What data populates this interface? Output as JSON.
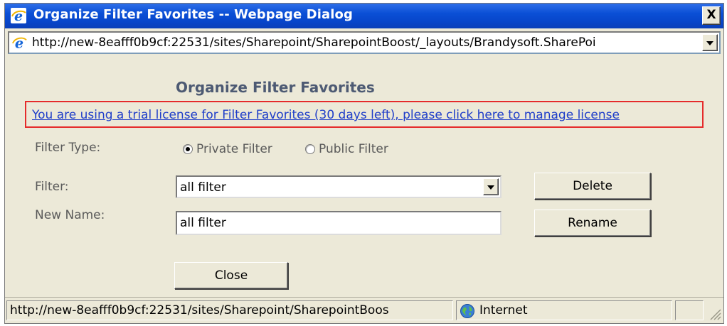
{
  "window": {
    "title": "Organize Filter Favorites -- Webpage Dialog",
    "close_glyph": "X",
    "address": "http://new-8eafff0b9cf:22531/sites/Sharepoint/SharepointBoost/_layouts/Brandysoft.SharePoi"
  },
  "dialog": {
    "heading": "Organize Filter Favorites",
    "license_link": "You are using a trial license for Filter Favorites (30 days left), please click here to manage license",
    "filter_type_label": "Filter Type:",
    "filter_type_options": [
      {
        "label": "Private Filter",
        "selected": true
      },
      {
        "label": "Public Filter",
        "selected": false
      }
    ],
    "filter_label": "Filter:",
    "filter_value": "all filter",
    "new_name_label": "New Name:",
    "new_name_value": "all filter",
    "delete_label": "Delete",
    "rename_label": "Rename",
    "close_label": "Close"
  },
  "statusbar": {
    "url": "http://new-8eafff0b9cf:22531/sites/Sharepoint/SharepointBoos",
    "zone": "Internet"
  },
  "colors": {
    "title_bar": "#0a4fd6",
    "link": "#1f3ec9",
    "license_border": "#e52b2b",
    "dialog_bg": "#ece9d8"
  },
  "icons": {
    "title": "ie-icon",
    "address": "ie-icon",
    "zone": "globe-icon"
  }
}
